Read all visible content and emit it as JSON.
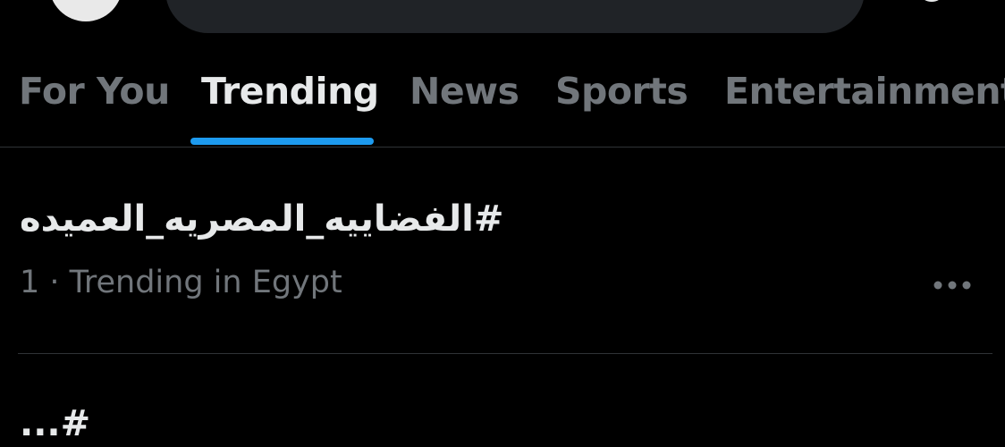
{
  "header": {
    "avatar_icon": "profile-avatar",
    "search_placeholder": "",
    "settings_icon": "gear-icon"
  },
  "tabs": [
    {
      "label": "For You",
      "active": false
    },
    {
      "label": "Trending",
      "active": true
    },
    {
      "label": "News",
      "active": false
    },
    {
      "label": "Sports",
      "active": false
    },
    {
      "label": "Entertainment",
      "active": false
    }
  ],
  "colors": {
    "background": "#000000",
    "primary_text": "#e7e9ea",
    "secondary_text": "#71767b",
    "accent": "#1d9bf0",
    "divider": "#2f3336"
  },
  "trends": [
    {
      "title": "#الفضاييه_المصريه_العميده",
      "meta": "1 · Trending in Egypt",
      "more_icon": "more-horizontal-icon"
    },
    {
      "title": "#...",
      "meta": ""
    }
  ]
}
